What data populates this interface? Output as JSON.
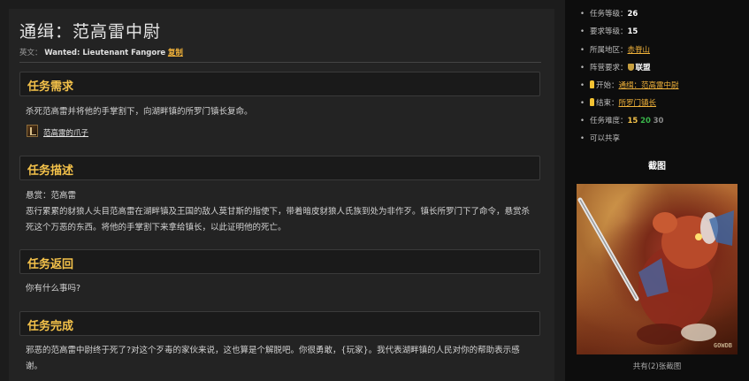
{
  "header": {
    "title": "通缉：范高雷中尉",
    "english_prefix": "英文：",
    "english_name": "Wanted: Lieutenant Fangore",
    "copy_label": "复制"
  },
  "sections": {
    "requirement": {
      "heading": "任务需求",
      "text": "杀死范高雷并将他的手掌割下，向湖畔镇的所罗门镇长复命。",
      "item_label": "范高雷的爪子",
      "item_icon": "claw-item-icon"
    },
    "description": {
      "heading": "任务描述",
      "line1": "悬赏：范高雷",
      "line2": "恶行累累的豺狼人头目范高雷在湖畔镇及王国的敌人莫甘斯的指使下，带着暗皮豺狼人氏族到处为非作歹。镇长所罗门下了命令，悬赏杀死这个万恶的东西。将他的手掌割下来拿给镇长，以此证明他的死亡。"
    },
    "return": {
      "heading": "任务返回",
      "text": "你有什么事吗?"
    },
    "complete": {
      "heading": "任务完成",
      "text": "邪恶的范高雷中尉终于死了?对这个歹毒的家伙来说，这也算是个解脱吧。你很勇敢，{玩家}。我代表湖畔镇的人民对你的帮助表示感谢。"
    }
  },
  "sidebar": {
    "quest_level_label": "任务等级：",
    "quest_level": "26",
    "req_level_label": "要求等级：",
    "req_level": "15",
    "zone_label": "所属地区：",
    "zone": "赤脊山",
    "faction_label": "阵营要求：",
    "faction": "联盟",
    "start_label": "开始：",
    "start": "通缉：范高雷中尉",
    "end_label": "结束：",
    "end": "所罗门镇长",
    "difficulty_label": "任务难度：",
    "difficulty": [
      "15",
      "20",
      "30"
    ],
    "shareable": "可以共享",
    "screenshot_title": "截图",
    "screenshot_count": "共有(2)张截图",
    "watermark": "GOWDB"
  },
  "colors": {
    "accent": "#f4c24a",
    "link": "#f2b33a",
    "difficulty_yellow": "#f4c24a",
    "difficulty_green": "#39b54a",
    "difficulty_grey": "#8a8a8a",
    "sidebar_bg": "#0d0d0d",
    "main_bg": "#232323"
  }
}
